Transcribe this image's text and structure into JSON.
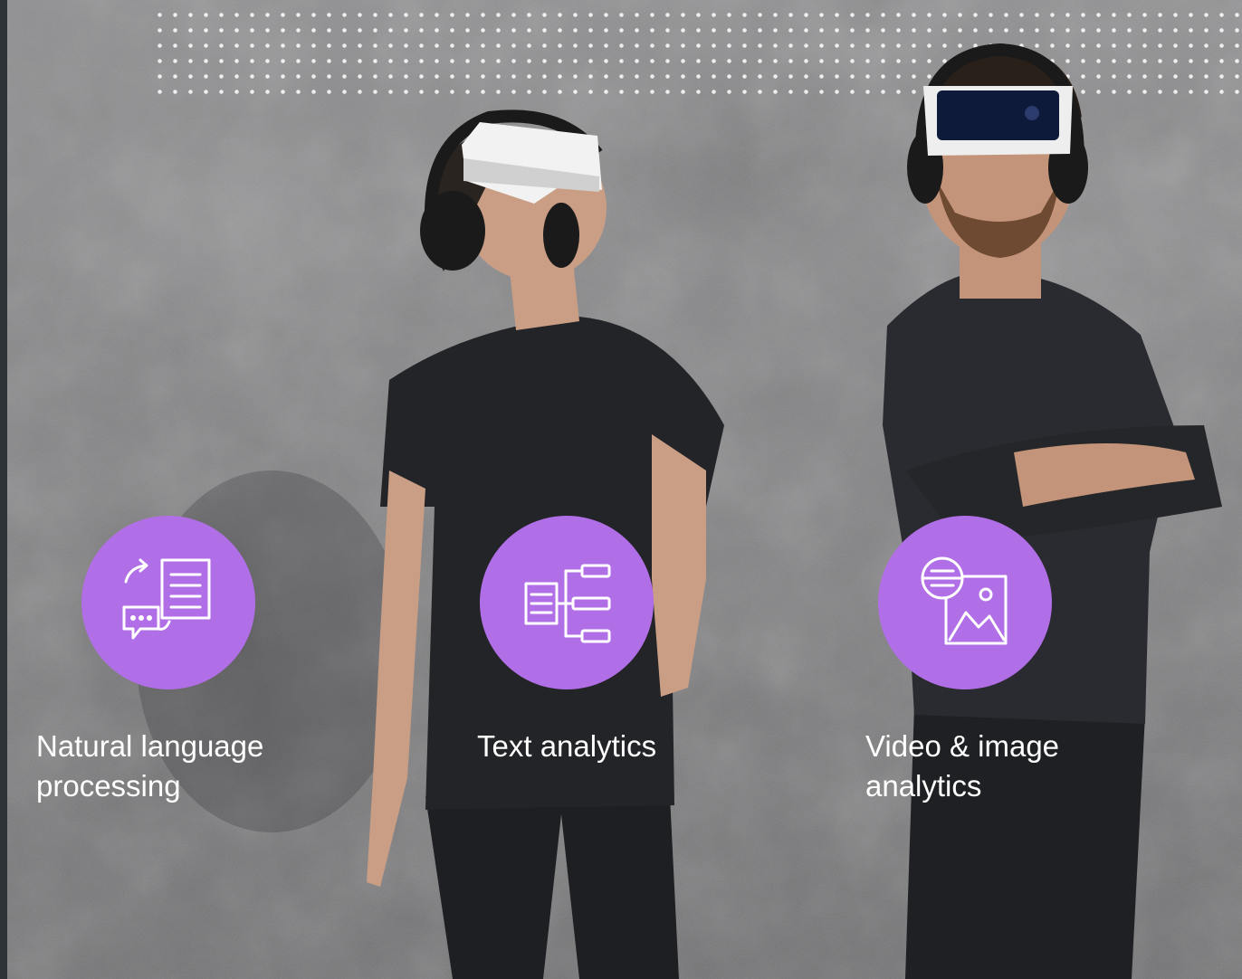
{
  "features": [
    {
      "label_line1": "Natural language",
      "label_line2": "processing",
      "icon": "chat-document-icon"
    },
    {
      "label_line1": "Text analytics",
      "label_line2": "",
      "icon": "document-tree-icon"
    },
    {
      "label_line1": "Video & image",
      "label_line2": "analytics",
      "icon": "image-analytics-icon"
    }
  ],
  "colors": {
    "accent": "#b06fe6",
    "wall": "#848486",
    "caption_text": "#ffffff"
  }
}
